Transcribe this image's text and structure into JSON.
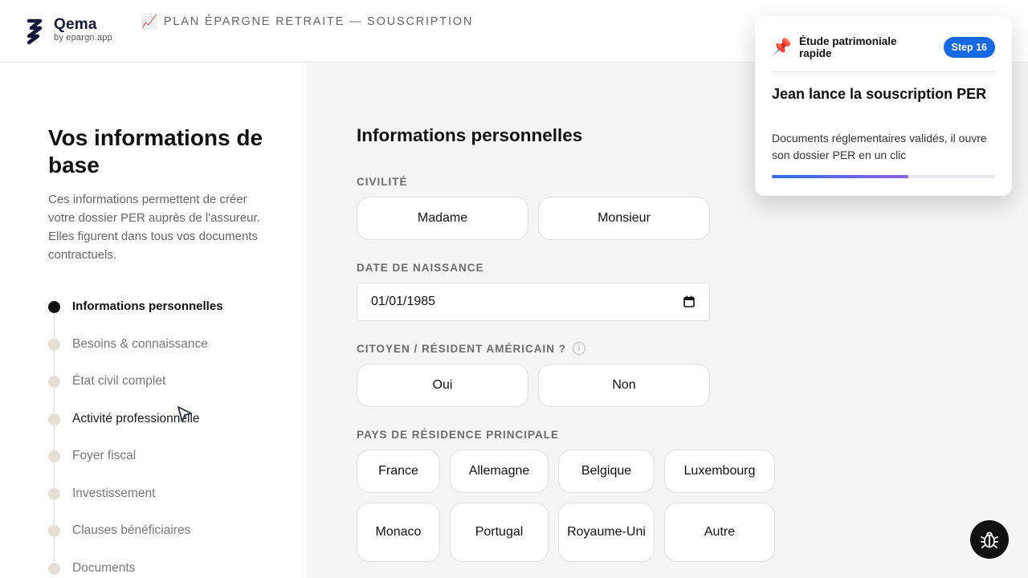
{
  "header": {
    "brand_name": "Qema",
    "brand_sub": "by epargn.app",
    "title_icon": "📈",
    "title": "PLAN ÉPARGNE RETRAITE — SOUSCRIPTION"
  },
  "sidebar": {
    "heading": "Vos informations de base",
    "description": "Ces informations permettent de créer votre dossier PER auprès de l'assureur. Elles figurent dans tous vos documents contractuels.",
    "steps": [
      {
        "label": "Informations personnelles",
        "active": true
      },
      {
        "label": "Besoins & connaissance"
      },
      {
        "label": "État civil complet"
      },
      {
        "label": "Activité professionnelle"
      },
      {
        "label": "Foyer fiscal"
      },
      {
        "label": "Investissement"
      },
      {
        "label": "Clauses bénéficiaires"
      },
      {
        "label": "Documents"
      }
    ]
  },
  "form": {
    "section_title": "Informations personnelles",
    "civility": {
      "label": "CIVILITÉ",
      "options": [
        "Madame",
        "Monsieur"
      ]
    },
    "birthdate": {
      "label": "DATE DE NAISSANCE",
      "value": "01/01/1985"
    },
    "us_person": {
      "label": "CITOYEN / RÉSIDENT AMÉRICAIN ?",
      "info": "i",
      "options": [
        "Oui",
        "Non"
      ]
    },
    "country": {
      "label": "PAYS DE RÉSIDENCE PRINCIPALE",
      "options": [
        "France",
        "Allemagne",
        "Belgique",
        "Luxembourg",
        "Monaco",
        "Portugal",
        "Royaume-Uni",
        "Autre"
      ]
    }
  },
  "tour_card": {
    "icon": "📌",
    "title": "Étude patrimoniale rapide",
    "badge": "Step 16",
    "heading": "Jean lance la souscription PER",
    "body": "Documents réglementaires validés, il ouvre son dossier PER en un clic",
    "progress": 0.61
  },
  "colors": {
    "accent": "#1668e3",
    "brand": "#14183a",
    "progress_end": "#8f5fe8"
  },
  "icons": [
    "logo-icon",
    "chart-icon",
    "calendar-icon",
    "info-icon",
    "pin-icon",
    "bug-icon",
    "cursor-icon"
  ]
}
